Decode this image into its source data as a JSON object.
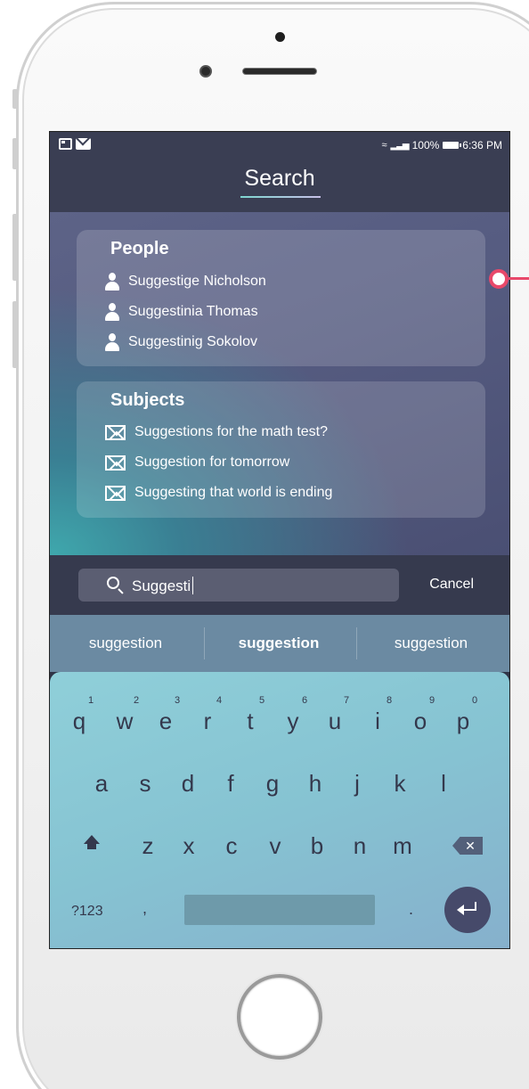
{
  "status_bar": {
    "battery": "100%",
    "time": "6:36 PM"
  },
  "header": {
    "title": "Search"
  },
  "people": {
    "heading": "People",
    "items": [
      "Suggestige Nicholson",
      "Suggestinia Thomas",
      "Suggestinig Sokolov"
    ]
  },
  "subjects": {
    "heading": "Subjects",
    "items": [
      "Suggestions for the math test?",
      "Suggestion for tomorrow",
      "Suggesting that world is ending"
    ]
  },
  "search": {
    "value": "Suggesti",
    "cancel_label": "Cancel"
  },
  "suggestions": [
    "suggestion",
    "suggestion",
    "suggestion"
  ],
  "keyboard": {
    "row1": [
      "q",
      "w",
      "e",
      "r",
      "t",
      "y",
      "u",
      "i",
      "o",
      "p"
    ],
    "row1_numbers": [
      "1",
      "2",
      "3",
      "4",
      "5",
      "6",
      "7",
      "8",
      "9",
      "0"
    ],
    "row2": [
      "a",
      "s",
      "d",
      "f",
      "g",
      "h",
      "j",
      "k",
      "l"
    ],
    "row3": [
      "z",
      "x",
      "c",
      "v",
      "b",
      "n",
      "m"
    ],
    "mode_key": "?123",
    "comma_key": ",",
    "period_key": "."
  },
  "colors": {
    "accent": "#e8486a",
    "keyboard": "#8fcfd9",
    "header": "#3a3e53",
    "enter_key": "#464a6a"
  },
  "icons": {
    "person": "person-icon",
    "mail": "mail-icon",
    "search": "search-icon",
    "shift": "shift-icon",
    "backspace": "backspace-icon",
    "enter": "enter-icon"
  }
}
